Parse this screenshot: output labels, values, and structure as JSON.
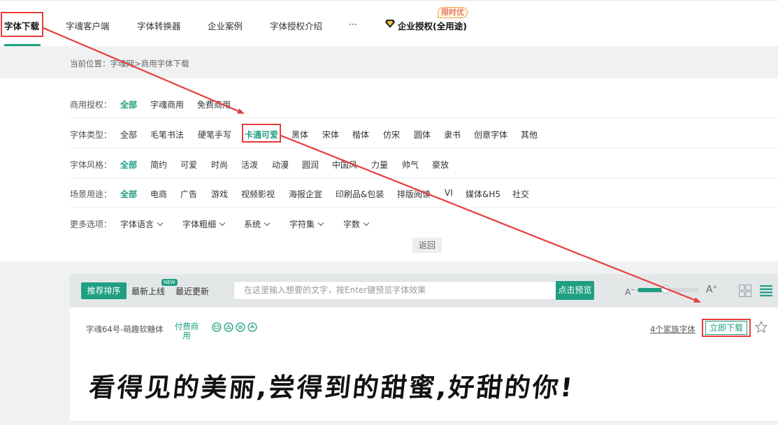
{
  "nav": {
    "items": [
      "字体下载",
      "字魂客户端",
      "字体转换器",
      "企业案例",
      "字体授权介绍",
      "···",
      "企业授权(全用途)"
    ],
    "badge": "限时优"
  },
  "breadcrumb": "当前位置：字魂网>商用字体下载",
  "filters": {
    "license": {
      "label": "商用授权：",
      "options": [
        "全部",
        "字魂商用",
        "免费商用"
      ]
    },
    "type": {
      "label": "字体类型：",
      "options": [
        "全部",
        "毛笔书法",
        "硬笔手写",
        "卡通可爱",
        "黑体",
        "宋体",
        "楷体",
        "仿宋",
        "圆体",
        "隶书",
        "创意字体",
        "其他"
      ]
    },
    "style": {
      "label": "字体风格：",
      "options": [
        "全部",
        "简约",
        "可爱",
        "时尚",
        "活泼",
        "动漫",
        "圆润",
        "中国风",
        "力量",
        "帅气",
        "豪放"
      ]
    },
    "scene": {
      "label": "场景用途：",
      "options": [
        "全部",
        "电商",
        "广告",
        "游戏",
        "视频影视",
        "海报企宣",
        "印刷品&包装",
        "排版阅读",
        "VI",
        "媒体&H5",
        "社交"
      ]
    },
    "more": {
      "label": "更多选项：",
      "options": [
        "字体语言",
        "字体粗细",
        "系统",
        "字符集",
        "字数"
      ]
    },
    "back": "返回"
  },
  "toolbar": {
    "sort_recommend": "推荐排序",
    "sort_new": "最新上线",
    "new_tag": "NEW",
    "sort_updated": "最近更新",
    "preview_placeholder": "在这里输入想要的文字，按Enter键预览字体效果",
    "preview_button": "点击预览",
    "size_small": "A",
    "size_big": "A",
    "size_level": 0.45
  },
  "font_card": {
    "name": "字魂64号-萌趣软糖体",
    "license": "付费商用",
    "family_link": "4个家族字体",
    "download": "立即下载",
    "sample": "看得见的美丽,尝得到的甜蜜,好甜的你!"
  },
  "colors": {
    "accent": "#1f9e82",
    "annotation": "#e83c3c"
  }
}
